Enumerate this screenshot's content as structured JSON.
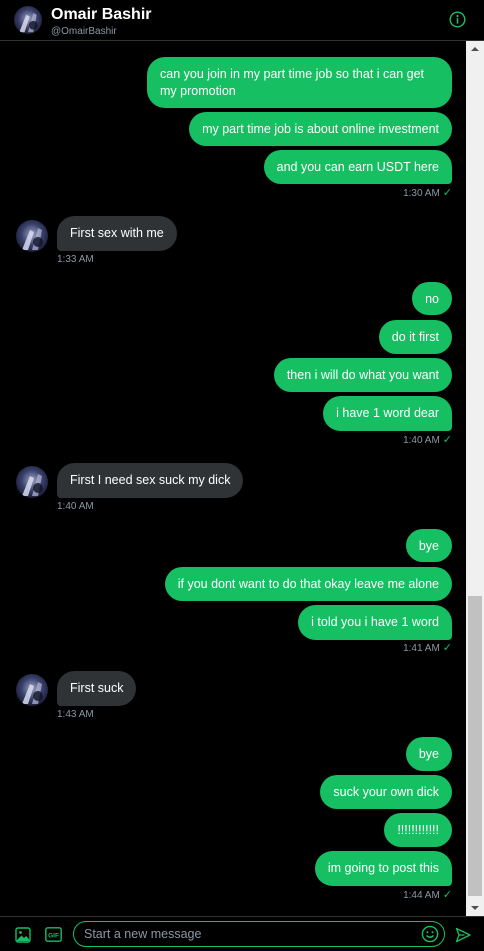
{
  "header": {
    "name": "Omair Bashir",
    "handle": "@OmairBashir",
    "info_icon": "info-icon"
  },
  "colors": {
    "accent": "#17bf63",
    "incoming_bubble": "#2f3336",
    "background": "#000000",
    "muted_text": "#8b98a5"
  },
  "messages": [
    {
      "dir": "out",
      "text": "can you join in my part time job so that i can get my promotion"
    },
    {
      "dir": "out",
      "text": "my part time job is about online investment"
    },
    {
      "dir": "out",
      "text": "and you can earn USDT here",
      "time": "1:30 AM"
    },
    {
      "dir": "in",
      "text": "First sex with me",
      "time": "1:33 AM"
    },
    {
      "dir": "out",
      "text": "no"
    },
    {
      "dir": "out",
      "text": "do it first"
    },
    {
      "dir": "out",
      "text": "then i will do what you want"
    },
    {
      "dir": "out",
      "text": "i have 1 word dear",
      "time": "1:40 AM"
    },
    {
      "dir": "in",
      "text": "First I need sex suck my dick",
      "time": "1:40 AM"
    },
    {
      "dir": "out",
      "text": "bye"
    },
    {
      "dir": "out",
      "text": "if you dont want to do that okay leave me alone"
    },
    {
      "dir": "out",
      "text": "i told you i have 1 word",
      "time": "1:41 AM"
    },
    {
      "dir": "in",
      "text": "First suck",
      "time": "1:43 AM"
    },
    {
      "dir": "out",
      "text": "bye"
    },
    {
      "dir": "out",
      "text": "suck your own dick"
    },
    {
      "dir": "out",
      "text": "!!!!!!!!!!!!"
    },
    {
      "dir": "out",
      "text": "im going to post this",
      "time": "1:44 AM"
    }
  ],
  "composer": {
    "placeholder": "Start a new message",
    "media_icon": "image-icon",
    "gif_icon": "gif-icon",
    "emoji_icon": "emoji-icon",
    "send_icon": "send-icon"
  }
}
